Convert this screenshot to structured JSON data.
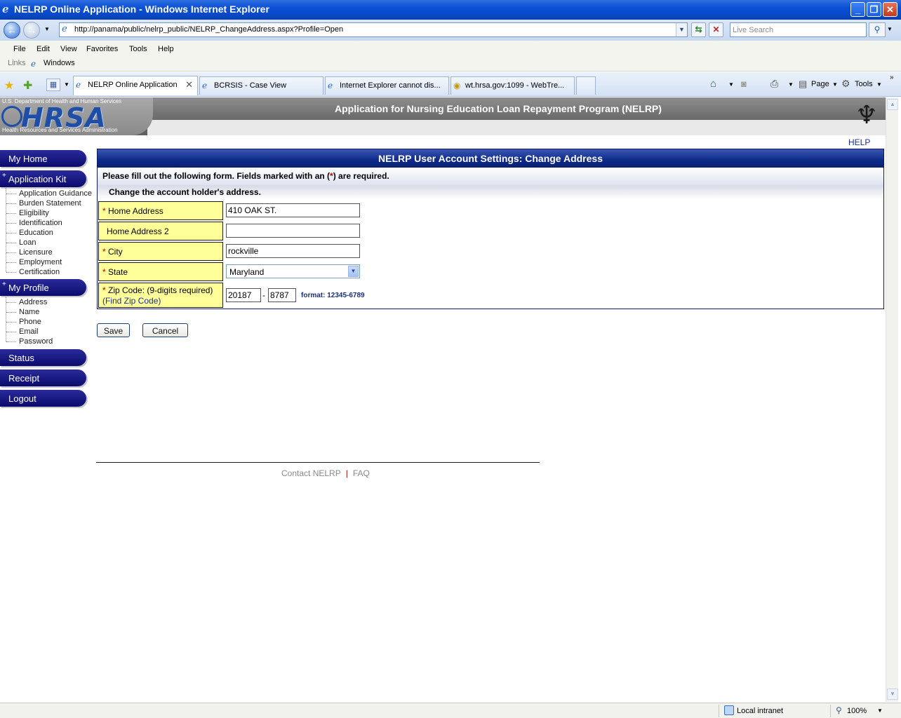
{
  "window": {
    "title": "NELRP Online Application - Windows Internet Explorer",
    "url": "http://panama/public/nelrp_public/NELRP_ChangeAddress.aspx?Profile=Open",
    "search_placeholder": "Live Search"
  },
  "menu": [
    "File",
    "Edit",
    "View",
    "Favorites",
    "Tools",
    "Help"
  ],
  "links": {
    "label": "Links",
    "item": "Windows"
  },
  "tabs": [
    {
      "label": "NELRP Online Application",
      "active": true
    },
    {
      "label": "BCRSIS - Case View",
      "active": false
    },
    {
      "label": "Internet Explorer cannot dis...",
      "active": false
    },
    {
      "label": "wt.hrsa.gov:1099 - WebTre...",
      "active": false
    }
  ],
  "toolbar": {
    "page": "Page",
    "tools": "Tools"
  },
  "banner": {
    "dept": "U.S. Department of Health and Human Services",
    "logo": "HRSA",
    "admin": "Health Resources and Services Administration",
    "title": "Application for Nursing Education Loan Repayment Program (NELRP)"
  },
  "help": "HELP",
  "nav": {
    "my_home": "My Home",
    "application_kit": "Application Kit",
    "application_kit_items": [
      "Application Guidance",
      "Burden Statement",
      "Eligibility",
      "Identification",
      "Education",
      "Loan",
      "Licensure",
      "Employment",
      "Certification"
    ],
    "my_profile": "My Profile",
    "my_profile_items": [
      "Address",
      "Name",
      "Phone",
      "Email",
      "Password"
    ],
    "status": "Status",
    "receipt": "Receipt",
    "logout": "Logout",
    "plus": "+"
  },
  "form": {
    "heading": "NELRP User Account Settings: Change Address",
    "instruction_pre": "Please fill out the following form. Fields marked with an (",
    "instruction_ast": "*",
    "instruction_post": ") are required.",
    "section": "Change the account holder's address.",
    "required_mark": "*",
    "fields": {
      "home_address": {
        "label": "Home Address",
        "value": "410 OAK ST."
      },
      "home_address2": {
        "label": "Home Address 2",
        "value": ""
      },
      "city": {
        "label": "City",
        "value": "rockville"
      },
      "state": {
        "label": "State",
        "value": "Maryland"
      },
      "zip": {
        "label": "Zip Code:  (9-digits required)",
        "link": "(Find Zip Code)",
        "value1": "20187",
        "value2": "8787",
        "separator": "-",
        "format": "format:  12345-6789"
      }
    },
    "save": "Save",
    "cancel": "Cancel"
  },
  "footer": {
    "contact": "Contact NELRP",
    "separator": "|",
    "faq": "FAQ"
  },
  "status": {
    "zone": "Local intranet",
    "zoom": "100%"
  }
}
